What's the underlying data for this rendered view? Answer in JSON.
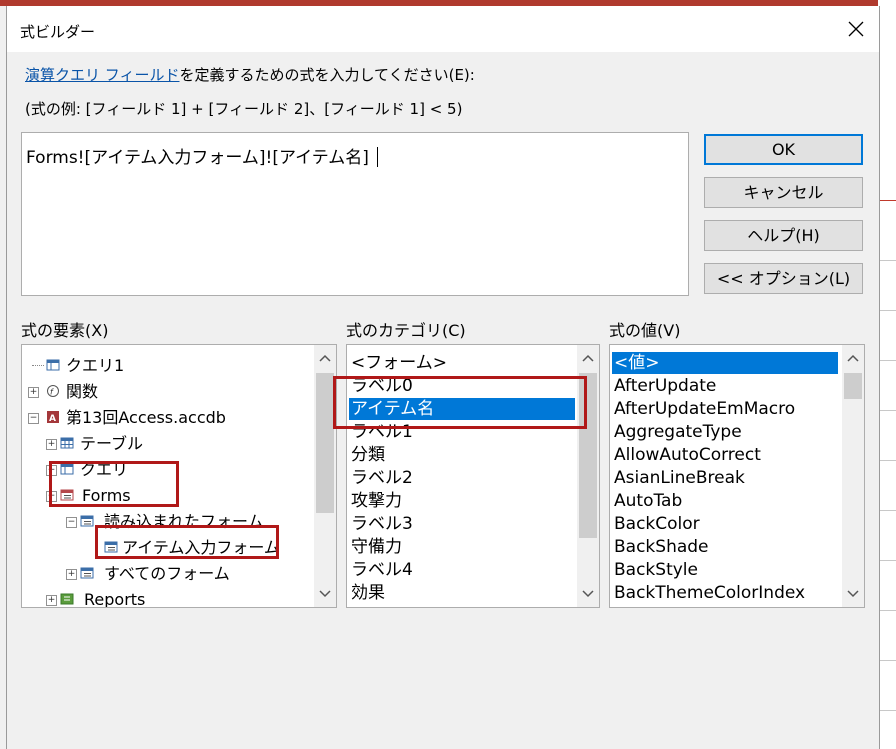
{
  "dialog": {
    "title": "式ビルダー",
    "instruction_link": "演算クエリ フィールド",
    "instruction_rest": "を定義するための式を入力してください(E):",
    "example": "(式の例: [フィールド 1] + [フィールド 2]、[フィールド 1] < 5)",
    "expression_value": "Forms![アイテム入力フォーム]![アイテム名]"
  },
  "buttons": {
    "ok": "OK",
    "cancel": "キャンセル",
    "help": "ヘルプ(H)",
    "options": "<< オプション(L)"
  },
  "labels": {
    "elements": "式の要素(X)",
    "categories": "式のカテゴリ(C)",
    "values": "式の値(V)"
  },
  "elements_tree": [
    {
      "label": "クエリ1",
      "icon": "query-icon",
      "expander": "none"
    },
    {
      "label": "関数",
      "icon": "function-icon",
      "expander": "plus"
    },
    {
      "label": "第13回Access.accdb",
      "icon": "access-db-icon",
      "expander": "minus"
    },
    {
      "label": "テーブル",
      "icon": "table-icon",
      "expander": "plus"
    },
    {
      "label": "クエリ",
      "icon": "query-icon",
      "expander": "plus"
    },
    {
      "label": "Forms",
      "icon": "form-icon",
      "expander": "minus"
    },
    {
      "label": "読み込まれたフォーム",
      "icon": "form-icon",
      "expander": "minus"
    },
    {
      "label": "アイテム入力フォーム",
      "icon": "form-icon",
      "expander": "none"
    },
    {
      "label": "すべてのフォーム",
      "icon": "form-icon",
      "expander": "plus"
    },
    {
      "label": "Reports",
      "icon": "report-icon",
      "expander": "plus"
    }
  ],
  "categories": [
    "<フォーム>",
    "ラベル0",
    "アイテム名",
    "ラベル1",
    "分類",
    "ラベル2",
    "攻撃力",
    "ラベル3",
    "守備力",
    "ラベル4",
    "効果"
  ],
  "selected_category": "アイテム名",
  "values": [
    "<値>",
    "AfterUpdate",
    "AfterUpdateEmMacro",
    "AggregateType",
    "AllowAutoCorrect",
    "AsianLineBreak",
    "AutoTab",
    "BackColor",
    "BackShade",
    "BackStyle",
    "BackThemeColorIndex"
  ],
  "selected_value": "<値>",
  "colors": {
    "selection": "#0078d7",
    "link": "#0a54a8",
    "highlight_box": "#b01818",
    "default_button_border": "#0078d7"
  }
}
